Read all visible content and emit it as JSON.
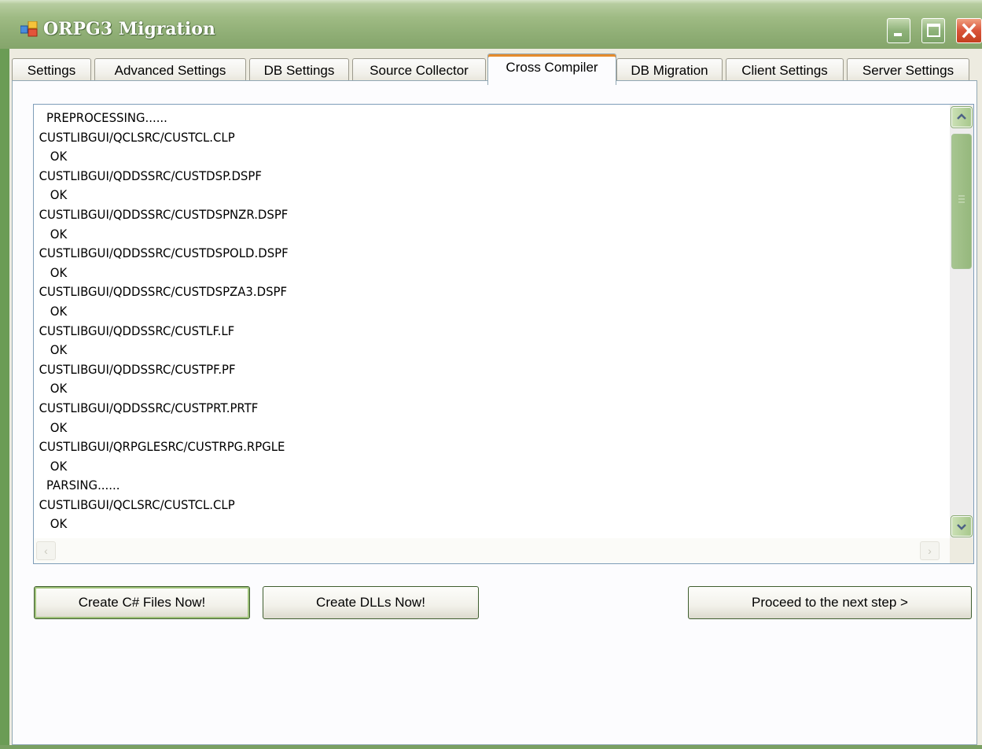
{
  "window": {
    "title": "ORPG3 Migration",
    "icon": "app-window-icon",
    "controls": [
      "minimize-icon",
      "maximize-icon",
      "close-icon"
    ]
  },
  "tabs": [
    {
      "label": "Settings",
      "active": false
    },
    {
      "label": "Advanced Settings",
      "active": false
    },
    {
      "label": "DB Settings",
      "active": false
    },
    {
      "label": "Source Collector",
      "active": false
    },
    {
      "label": "Cross Compiler",
      "active": true
    },
    {
      "label": "DB Migration",
      "active": false
    },
    {
      "label": "Client Settings",
      "active": false
    },
    {
      "label": "Server Settings",
      "active": false
    }
  ],
  "log": {
    "lines": [
      "  PREPROCESSING......",
      "CUSTLIBGUI/QCLSRC/CUSTCL.CLP",
      "   OK",
      "CUSTLIBGUI/QDDSSRC/CUSTDSP.DSPF",
      "   OK",
      "CUSTLIBGUI/QDDSSRC/CUSTDSPNZR.DSPF",
      "   OK",
      "CUSTLIBGUI/QDDSSRC/CUSTDSPOLD.DSPF",
      "   OK",
      "CUSTLIBGUI/QDDSSRC/CUSTDSPZA3.DSPF",
      "   OK",
      "CUSTLIBGUI/QDDSSRC/CUSTLF.LF",
      "   OK",
      "CUSTLIBGUI/QDDSSRC/CUSTPF.PF",
      "   OK",
      "CUSTLIBGUI/QDDSSRC/CUSTPRT.PRTF",
      "   OK",
      "CUSTLIBGUI/QRPGLESRC/CUSTRPG.RPGLE",
      "   OK",
      "  PARSING......",
      "CUSTLIBGUI/QCLSRC/CUSTCL.CLP",
      "   OK"
    ]
  },
  "buttons": {
    "create_cs": "Create C# Files Now!",
    "create_dll": "Create DLLs Now!",
    "next_step": "Proceed to the next step >"
  },
  "colors": {
    "title_bar": "#8fae75",
    "client_bg": "#edebe0",
    "active_tab_accent": "#e68b2c",
    "close_button": "#d9543a"
  }
}
